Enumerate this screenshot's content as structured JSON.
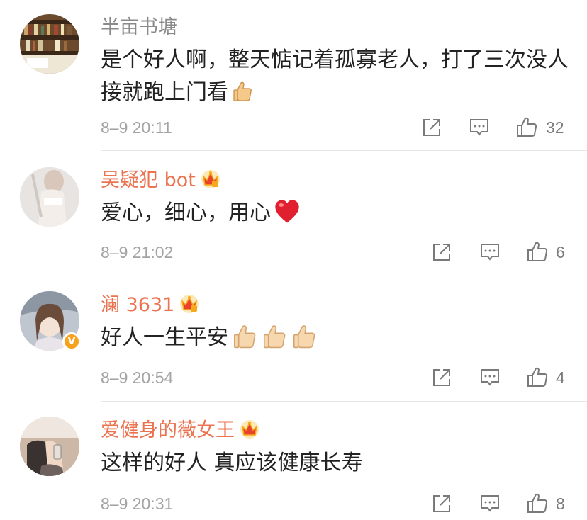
{
  "colors": {
    "username_gray": "#8a8a8a",
    "username_vip": "#eb7350",
    "verified_badge": "#f7a11e",
    "heart": "#e0202e"
  },
  "icons": [
    "share-icon",
    "comment-icon",
    "like-icon",
    "crown-badge-icon",
    "thumbs-up-emoji",
    "red-heart-emoji",
    "verified-badge-icon"
  ],
  "comments": [
    {
      "username": "半亩书塘",
      "username_style": "plain",
      "has_crown": false,
      "text": "是个好人啊，整天惦记着孤寡老人，打了三次没人接就跑上门看",
      "emoji": [
        "thumbs-up-emoji"
      ],
      "time": "8–9 20:11",
      "likes": "32"
    },
    {
      "username": "吴疑犯 bot",
      "username_style": "vip",
      "has_crown": true,
      "text": "爱心，细心，用心",
      "emoji": [
        "red-heart-emoji"
      ],
      "time": "8–9 21:02",
      "likes": "6"
    },
    {
      "username": "澜 3631",
      "username_style": "vip",
      "has_crown": true,
      "verified": true,
      "text": "好人一生平安",
      "emoji": [
        "thumbs-up-emoji",
        "thumbs-up-emoji",
        "thumbs-up-emoji"
      ],
      "time": "8–9 20:54",
      "likes": "4"
    },
    {
      "username": "爱健身的薇女王",
      "username_style": "vip",
      "has_crown": true,
      "text": "这样的好人 真应该健康长寿",
      "emoji": [],
      "time": "8–9 20:31",
      "likes": "8"
    }
  ]
}
